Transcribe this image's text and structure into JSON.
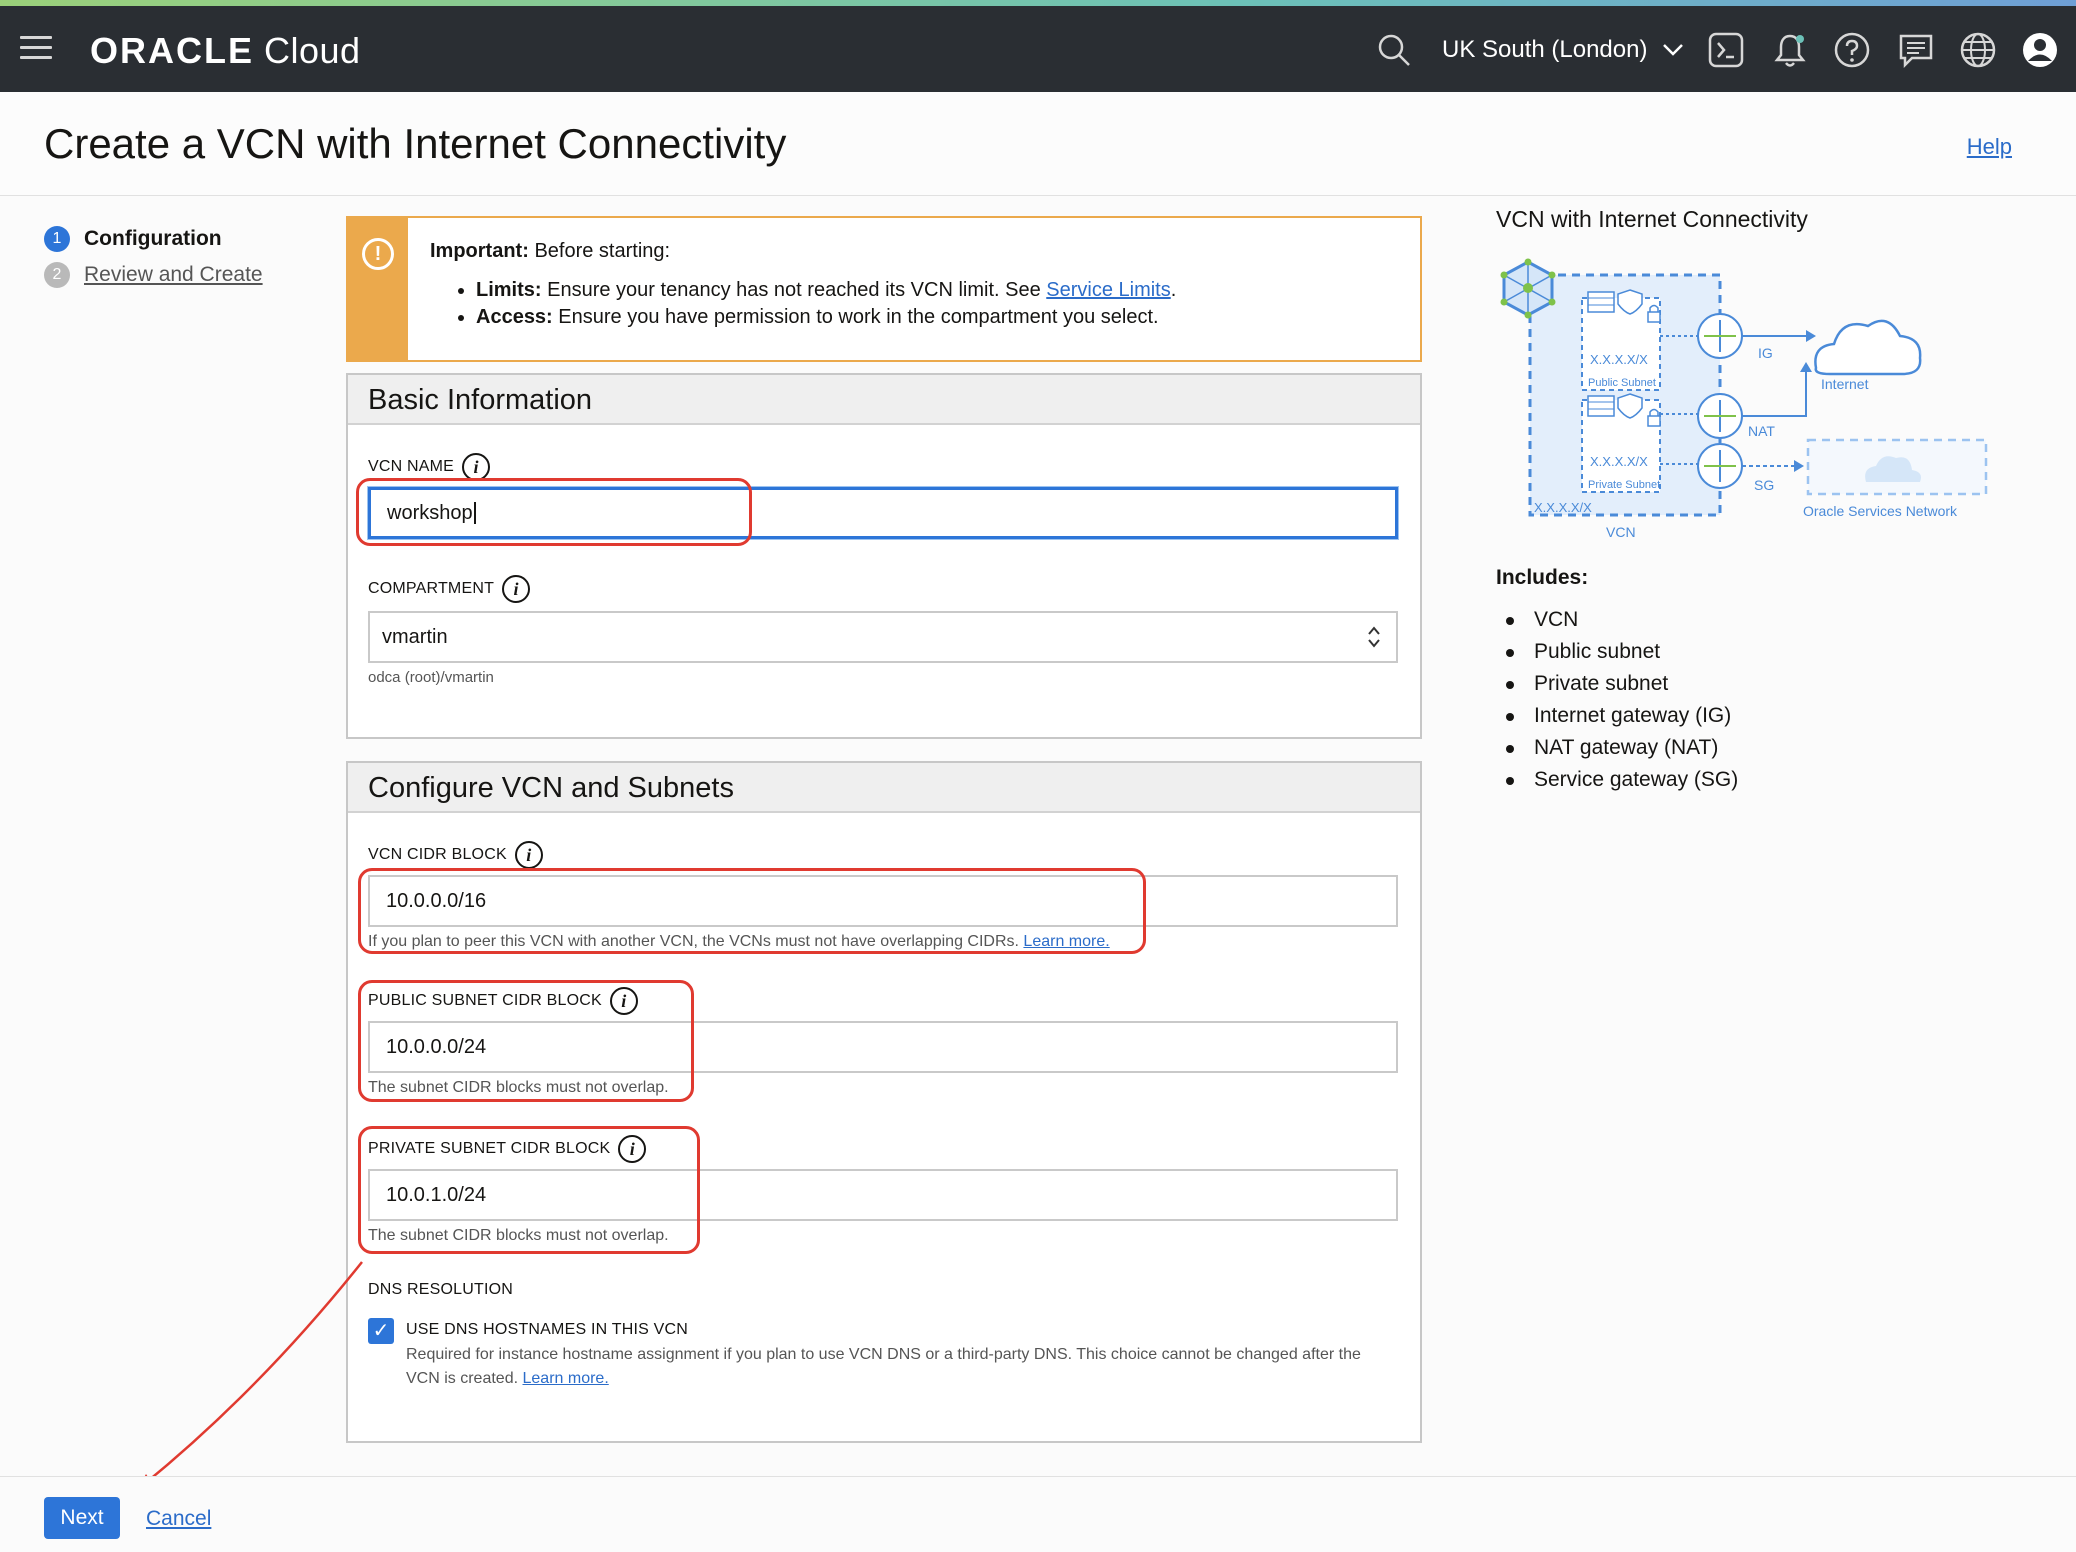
{
  "header": {
    "logo_brand": "ORACLE",
    "logo_product": "Cloud",
    "region": "UK South (London)"
  },
  "page": {
    "title": "Create a VCN with Internet Connectivity",
    "help_link": "Help"
  },
  "steps": [
    {
      "number": "1",
      "label": "Configuration",
      "active": true
    },
    {
      "number": "2",
      "label": "Review and Create",
      "active": false
    }
  ],
  "notice": {
    "lead_bold": "Important:",
    "lead_text": "Before starting:",
    "items": [
      {
        "bold": "Limits:",
        "text": "Ensure your tenancy has not reached its VCN limit. See ",
        "link": "Service Limits",
        "after": "."
      },
      {
        "bold": "Access:",
        "text": "Ensure you have permission to work in the compartment you select.",
        "link": "",
        "after": ""
      }
    ]
  },
  "basic_info": {
    "heading": "Basic Information",
    "vcn_name_label": "VCN NAME",
    "vcn_name_value": "workshop",
    "compartment_label": "COMPARTMENT",
    "compartment_value": "vmartin",
    "compartment_path": "odca (root)/vmartin"
  },
  "configure": {
    "heading": "Configure VCN and Subnets",
    "vcn_cidr_label": "VCN CIDR BLOCK",
    "vcn_cidr_value": "10.0.0.0/16",
    "vcn_cidr_help": "If you plan to peer this VCN with another VCN, the VCNs must not have overlapping CIDRs.",
    "vcn_cidr_help_link": "Learn more.",
    "public_label": "PUBLIC SUBNET CIDR BLOCK",
    "public_value": "10.0.0.0/24",
    "public_help": "The subnet CIDR blocks must not overlap.",
    "private_label": "PRIVATE SUBNET CIDR BLOCK",
    "private_value": "10.0.1.0/24",
    "private_help": "The subnet CIDR blocks must not overlap.",
    "dns_label": "DNS RESOLUTION",
    "dns_checkbox_label": "USE DNS HOSTNAMES IN THIS VCN",
    "dns_checked": true,
    "dns_help_line1": "Required for instance hostname assignment if you plan to use VCN DNS or a third-party DNS. This choice cannot be changed after the",
    "dns_help_line2": "VCN is created.",
    "dns_help_link": "Learn more."
  },
  "diagram": {
    "title": "VCN with Internet Connectivity",
    "labels": {
      "public_cidr": "X.X.X.X/X",
      "public_subnet": "Public Subnet",
      "private_cidr": "X.X.X.X/X",
      "private_subnet": "Private Subnet",
      "vcn_cidr": "X.X.X.X/X",
      "vcn": "VCN",
      "ig": "IG",
      "nat": "NAT",
      "sg": "SG",
      "internet": "Internet",
      "osn": "Oracle Services Network"
    },
    "includes_title": "Includes:",
    "includes": [
      "VCN",
      "Public subnet",
      "Private subnet",
      "Internet gateway (IG)",
      "NAT gateway (NAT)",
      "Service gateway (SG)"
    ]
  },
  "footer": {
    "next_label": "Next",
    "cancel_label": "Cancel"
  },
  "colors": {
    "accent_blue": "#2d75d8",
    "annotation_red": "#e03a30",
    "warning_orange": "#eba94c",
    "header_bg": "#2a2e33"
  }
}
